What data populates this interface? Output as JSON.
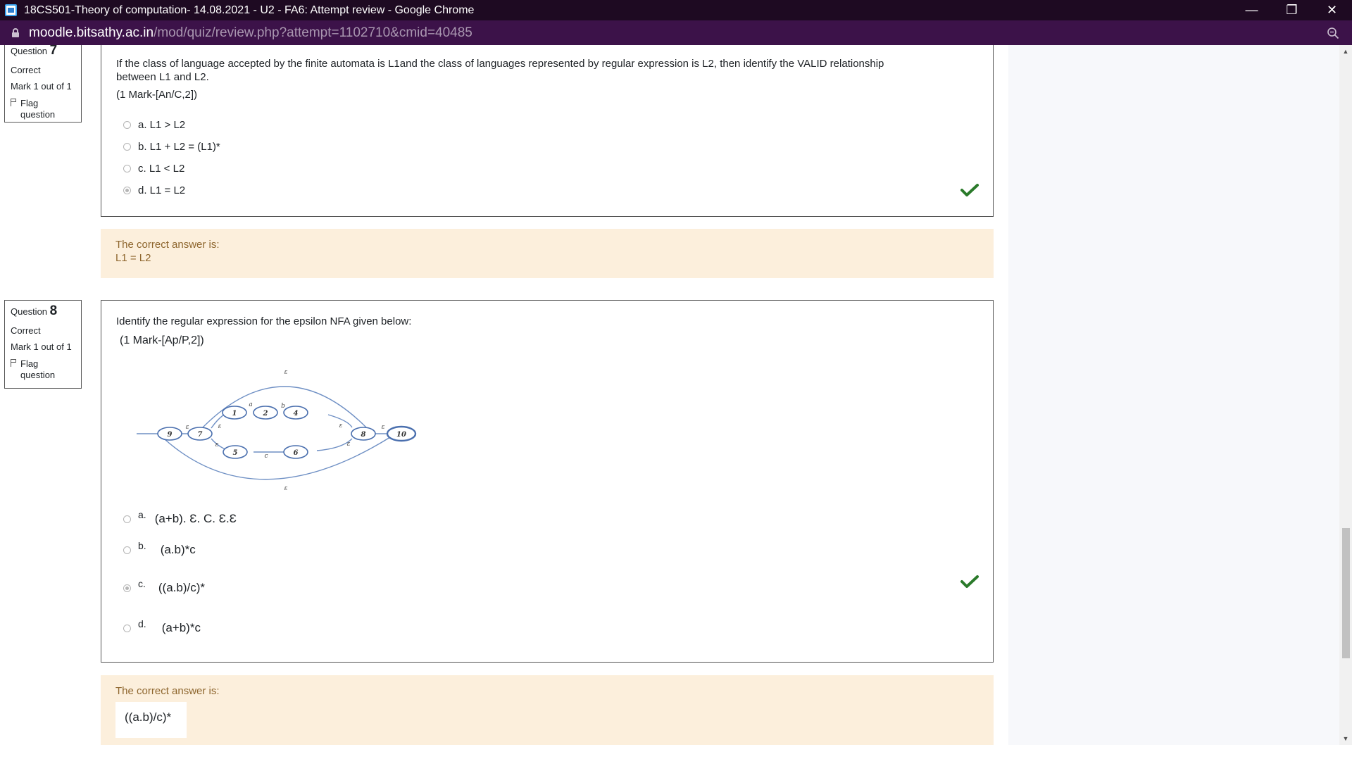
{
  "window": {
    "title": "18CS501-Theory of computation- 14.08.2021 - U2 - FA6: Attempt review - Google Chrome",
    "minimize": "—",
    "restore": "❐",
    "close": "✕"
  },
  "address": {
    "host": "moodle.bitsathy.ac.in",
    "path": "/mod/quiz/review.php?attempt=1102710&cmid=40485"
  },
  "q7": {
    "label": "Question",
    "number": "7",
    "state": "Correct",
    "mark": "Mark 1 out of 1",
    "flag": "Flag question",
    "text_line1": "If the class of language accepted by the finite automata is L1and the class of languages represented by regular expression is L2, then identify the VALID relationship",
    "text_line2": "between L1 and L2.",
    "mark_code": "(1 Mark-[An/C,2])",
    "options": [
      {
        "label": "a. L1 > L2",
        "selected": false
      },
      {
        "label": "b. L1 + L2 = (L1)*",
        "selected": false
      },
      {
        "label": "c. L1 < L2",
        "selected": false
      },
      {
        "label": "d. L1 = L2",
        "selected": true
      }
    ],
    "feedback_label": "The correct answer is:",
    "feedback_answer": "L1 = L2"
  },
  "q8": {
    "label": "Question",
    "number": "8",
    "state": "Correct",
    "mark": "Mark 1 out of 1",
    "flag": "Flag question",
    "text": "Identify the regular expression for the epsilon NFA given below:",
    "mark_code": "(1 Mark-[Ap/P,2])",
    "diagram": {
      "states": [
        "9",
        "7",
        "1",
        "2",
        "4",
        "5",
        "6",
        "8",
        "10"
      ],
      "edge_labels": [
        "ε",
        "a",
        "b",
        "c"
      ]
    },
    "options": [
      {
        "letter": "a.",
        "text": "(a+b). Ɛ. C. Ɛ.Ɛ",
        "selected": false
      },
      {
        "letter": "b.",
        "text": "(a.b)*c",
        "selected": false
      },
      {
        "letter": "c.",
        "text": "((a.b)/c)*",
        "selected": true
      },
      {
        "letter": "d.",
        "text": "(a+b)*c",
        "selected": false
      }
    ],
    "feedback_label": "The correct answer is:",
    "feedback_answer": "((a.b)/c)*"
  },
  "colors": {
    "titlebar": "#1e0a22",
    "addressbar": "#3c1249",
    "feedback_bg": "#fcefdc",
    "check": "#2a7a2a"
  }
}
